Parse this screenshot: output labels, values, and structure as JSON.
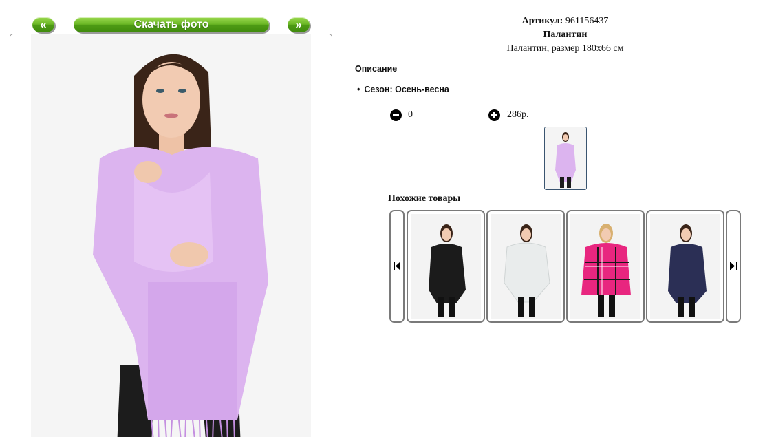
{
  "nav": {
    "prev_label": "«",
    "download_label": "Скачать фото",
    "next_label": "»"
  },
  "product": {
    "sku_label": "Артикул:",
    "sku": "961156437",
    "name": "Палантин",
    "subtitle": "Палантин, размер 180х66 см"
  },
  "description": {
    "title": "Описание",
    "season": "Сезон: Осень-весна"
  },
  "order": {
    "quantity": "0",
    "price": "286р."
  },
  "similar": {
    "title": "Похожие товары",
    "items": [
      {
        "color": "#1b1b1b"
      },
      {
        "color": "#e9ecec"
      },
      {
        "color": "#e8267f"
      },
      {
        "color": "#2b2f55"
      }
    ]
  },
  "colors": {
    "accent_green": "#5aa81c",
    "scarf_main": "#dcb4ef",
    "skin": "#f0c8ad",
    "hair": "#3a2418"
  }
}
